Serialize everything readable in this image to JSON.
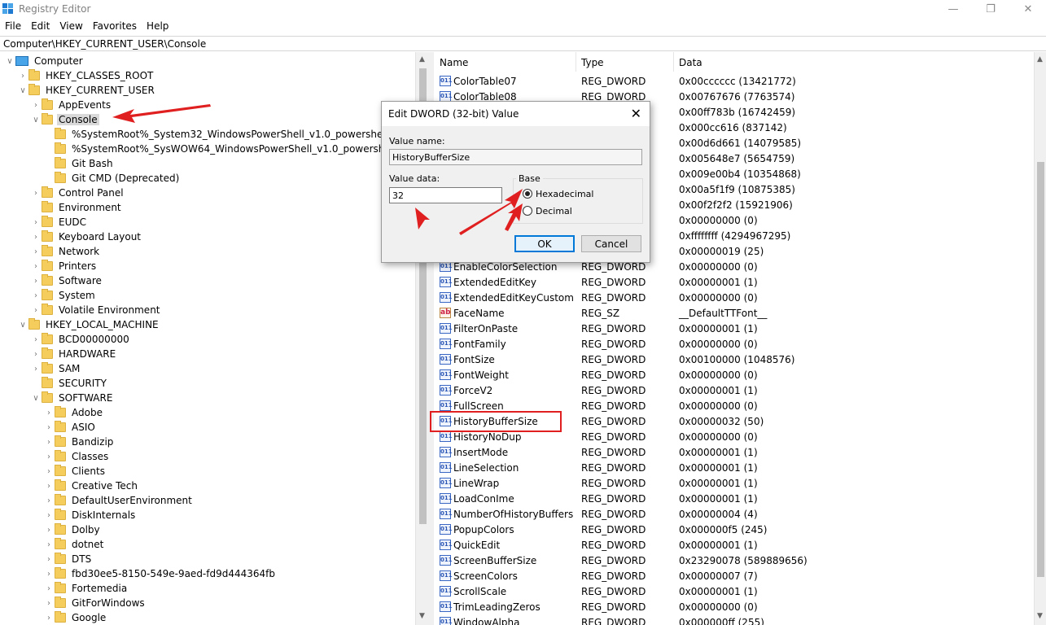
{
  "window": {
    "title": "Registry Editor"
  },
  "menu": [
    "File",
    "Edit",
    "View",
    "Favorites",
    "Help"
  ],
  "address": "Computer\\HKEY_CURRENT_USER\\Console",
  "tree": [
    {
      "label": "Computer",
      "level": 0,
      "exp": "v",
      "icon": "pc"
    },
    {
      "label": "HKEY_CLASSES_ROOT",
      "level": 1,
      "exp": ">"
    },
    {
      "label": "HKEY_CURRENT_USER",
      "level": 1,
      "exp": "v"
    },
    {
      "label": "AppEvents",
      "level": 2,
      "exp": ">"
    },
    {
      "label": "Console",
      "level": 2,
      "exp": "v",
      "selected": true
    },
    {
      "label": "%SystemRoot%_System32_WindowsPowerShell_v1.0_powershell.exe",
      "level": 3,
      "exp": ""
    },
    {
      "label": "%SystemRoot%_SysWOW64_WindowsPowerShell_v1.0_powershell.exe",
      "level": 3,
      "exp": ""
    },
    {
      "label": "Git Bash",
      "level": 3,
      "exp": ""
    },
    {
      "label": "Git CMD (Deprecated)",
      "level": 3,
      "exp": ""
    },
    {
      "label": "Control Panel",
      "level": 2,
      "exp": ">"
    },
    {
      "label": "Environment",
      "level": 2,
      "exp": ""
    },
    {
      "label": "EUDC",
      "level": 2,
      "exp": ">"
    },
    {
      "label": "Keyboard Layout",
      "level": 2,
      "exp": ">"
    },
    {
      "label": "Network",
      "level": 2,
      "exp": ">"
    },
    {
      "label": "Printers",
      "level": 2,
      "exp": ">"
    },
    {
      "label": "Software",
      "level": 2,
      "exp": ">"
    },
    {
      "label": "System",
      "level": 2,
      "exp": ">"
    },
    {
      "label": "Volatile Environment",
      "level": 2,
      "exp": ">"
    },
    {
      "label": "HKEY_LOCAL_MACHINE",
      "level": 1,
      "exp": "v"
    },
    {
      "label": "BCD00000000",
      "level": 2,
      "exp": ">"
    },
    {
      "label": "HARDWARE",
      "level": 2,
      "exp": ">"
    },
    {
      "label": "SAM",
      "level": 2,
      "exp": ">"
    },
    {
      "label": "SECURITY",
      "level": 2,
      "exp": ""
    },
    {
      "label": "SOFTWARE",
      "level": 2,
      "exp": "v"
    },
    {
      "label": "Adobe",
      "level": 3,
      "exp": ">"
    },
    {
      "label": "ASIO",
      "level": 3,
      "exp": ">"
    },
    {
      "label": "Bandizip",
      "level": 3,
      "exp": ">"
    },
    {
      "label": "Classes",
      "level": 3,
      "exp": ">"
    },
    {
      "label": "Clients",
      "level": 3,
      "exp": ">"
    },
    {
      "label": "Creative Tech",
      "level": 3,
      "exp": ">"
    },
    {
      "label": "DefaultUserEnvironment",
      "level": 3,
      "exp": ">"
    },
    {
      "label": "DiskInternals",
      "level": 3,
      "exp": ">"
    },
    {
      "label": "Dolby",
      "level": 3,
      "exp": ">"
    },
    {
      "label": "dotnet",
      "level": 3,
      "exp": ">"
    },
    {
      "label": "DTS",
      "level": 3,
      "exp": ">"
    },
    {
      "label": "fbd30ee5-8150-549e-9aed-fd9d444364fb",
      "level": 3,
      "exp": ">"
    },
    {
      "label": "Fortemedia",
      "level": 3,
      "exp": ">"
    },
    {
      "label": "GitForWindows",
      "level": 3,
      "exp": ">"
    },
    {
      "label": "Google",
      "level": 3,
      "exp": ">"
    }
  ],
  "list": {
    "columns": [
      "Name",
      "Type",
      "Data"
    ],
    "rows": [
      {
        "name": "ColorTable07",
        "type": "REG_DWORD",
        "data": "0x00cccccc (13421772)"
      },
      {
        "name": "ColorTable08",
        "type": "REG_DWORD",
        "data": "0x00767676 (7763574)"
      },
      {
        "name": "",
        "type": "",
        "data": "0x00ff783b (16742459)"
      },
      {
        "name": "",
        "type": "",
        "data": "0x000cc616 (837142)"
      },
      {
        "name": "",
        "type": "",
        "data": "0x00d6d661 (14079585)"
      },
      {
        "name": "",
        "type": "",
        "data": "0x005648e7 (5654759)"
      },
      {
        "name": "",
        "type": "",
        "data": "0x009e00b4 (10354868)"
      },
      {
        "name": "",
        "type": "",
        "data": "0x00a5f1f9 (10875385)"
      },
      {
        "name": "",
        "type": "",
        "data": "0x00f2f2f2 (15921906)"
      },
      {
        "name": "",
        "type": "",
        "data": "0x00000000 (0)"
      },
      {
        "name": "",
        "type": "",
        "data": "0xffffffff (4294967295)"
      },
      {
        "name": "",
        "type": "",
        "data": "0x00000019 (25)"
      },
      {
        "name": "EnableColorSelection",
        "type": "REG_DWORD",
        "data": "0x00000000 (0)"
      },
      {
        "name": "ExtendedEditKey",
        "type": "REG_DWORD",
        "data": "0x00000001 (1)"
      },
      {
        "name": "ExtendedEditKeyCustom",
        "type": "REG_DWORD",
        "data": "0x00000000 (0)"
      },
      {
        "name": "FaceName",
        "type": "REG_SZ",
        "data": "__DefaultTTFont__",
        "icon": "ab"
      },
      {
        "name": "FilterOnPaste",
        "type": "REG_DWORD",
        "data": "0x00000001 (1)"
      },
      {
        "name": "FontFamily",
        "type": "REG_DWORD",
        "data": "0x00000000 (0)"
      },
      {
        "name": "FontSize",
        "type": "REG_DWORD",
        "data": "0x00100000 (1048576)"
      },
      {
        "name": "FontWeight",
        "type": "REG_DWORD",
        "data": "0x00000000 (0)"
      },
      {
        "name": "ForceV2",
        "type": "REG_DWORD",
        "data": "0x00000001 (1)"
      },
      {
        "name": "FullScreen",
        "type": "REG_DWORD",
        "data": "0x00000000 (0)"
      },
      {
        "name": "HistoryBufferSize",
        "type": "REG_DWORD",
        "data": "0x00000032 (50)"
      },
      {
        "name": "HistoryNoDup",
        "type": "REG_DWORD",
        "data": "0x00000000 (0)"
      },
      {
        "name": "InsertMode",
        "type": "REG_DWORD",
        "data": "0x00000001 (1)"
      },
      {
        "name": "LineSelection",
        "type": "REG_DWORD",
        "data": "0x00000001 (1)"
      },
      {
        "name": "LineWrap",
        "type": "REG_DWORD",
        "data": "0x00000001 (1)"
      },
      {
        "name": "LoadConIme",
        "type": "REG_DWORD",
        "data": "0x00000001 (1)"
      },
      {
        "name": "NumberOfHistoryBuffers",
        "type": "REG_DWORD",
        "data": "0x00000004 (4)"
      },
      {
        "name": "PopupColors",
        "type": "REG_DWORD",
        "data": "0x000000f5 (245)"
      },
      {
        "name": "QuickEdit",
        "type": "REG_DWORD",
        "data": "0x00000001 (1)"
      },
      {
        "name": "ScreenBufferSize",
        "type": "REG_DWORD",
        "data": "0x23290078 (589889656)"
      },
      {
        "name": "ScreenColors",
        "type": "REG_DWORD",
        "data": "0x00000007 (7)"
      },
      {
        "name": "ScrollScale",
        "type": "REG_DWORD",
        "data": "0x00000001 (1)"
      },
      {
        "name": "TrimLeadingZeros",
        "type": "REG_DWORD",
        "data": "0x00000000 (0)"
      },
      {
        "name": "WindowAlpha",
        "type": "REG_DWORD",
        "data": "0x000000ff (255)"
      }
    ]
  },
  "dialog": {
    "title": "Edit DWORD (32-bit) Value",
    "value_name_label": "Value name:",
    "value_name": "HistoryBufferSize",
    "value_data_label": "Value data:",
    "value_data": "32",
    "base_label": "Base",
    "hex_label": "Hexadecimal",
    "dec_label": "Decimal",
    "ok": "OK",
    "cancel": "Cancel"
  },
  "colors": {
    "annotation": "#e02020",
    "selection": "#d9d9d9",
    "folder": "#f4cd5c"
  }
}
